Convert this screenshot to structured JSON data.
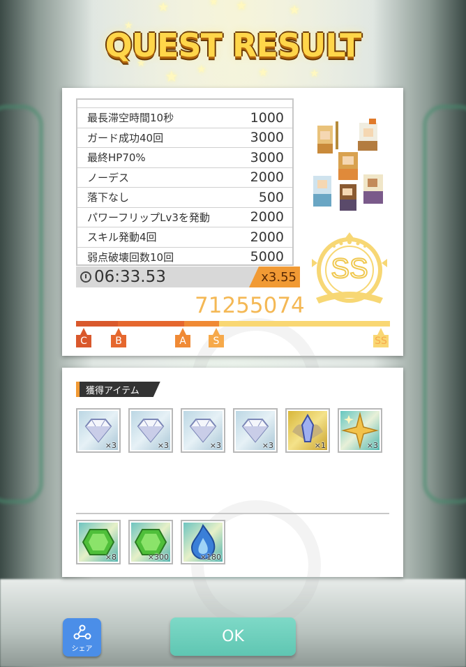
{
  "title": "QUEST RESULT",
  "bonuses": {
    "partial_top": "",
    "rows": [
      {
        "label": "最長滞空時間10秒",
        "points": "1000"
      },
      {
        "label": "ガード成功40回",
        "points": "3000"
      },
      {
        "label": "最終HP70%",
        "points": "3000"
      },
      {
        "label": "ノーデス",
        "points": "2000"
      },
      {
        "label": "落下なし",
        "points": "500"
      },
      {
        "label": "パワーフリップLv3を発動",
        "points": "2000"
      },
      {
        "label": "スキル発動4回",
        "points": "2000"
      },
      {
        "label": "弱点破壊回数10回",
        "points": "5000"
      }
    ]
  },
  "clear_time": "06:33.53",
  "multiplier": "x3.55",
  "score": "71255074",
  "rank": {
    "grade": "SS",
    "markers": [
      {
        "label": "C",
        "color": "#d9582c"
      },
      {
        "label": "B",
        "color": "#e5672e"
      },
      {
        "label": "A",
        "color": "#f08a35"
      },
      {
        "label": "S",
        "color": "#f6a94a"
      },
      {
        "label": "SS",
        "color": "#f9d773"
      }
    ]
  },
  "items_section": {
    "label": "獲得アイテム",
    "row1": [
      {
        "icon": "diamond-icon",
        "qty": "×3"
      },
      {
        "icon": "diamond-icon",
        "qty": "×3"
      },
      {
        "icon": "diamond-icon",
        "qty": "×3"
      },
      {
        "icon": "diamond-icon",
        "qty": "×3"
      },
      {
        "icon": "winged-crystal-icon",
        "qty": "×1"
      },
      {
        "icon": "sparkle-star-icon",
        "qty": "×3"
      }
    ],
    "row2": [
      {
        "icon": "green-gem-icon",
        "qty": "×8"
      },
      {
        "icon": "green-gem-icon",
        "qty": "×300"
      },
      {
        "icon": "blue-flame-icon",
        "qty": "×180"
      }
    ]
  },
  "buttons": {
    "share": "シェア",
    "ok": "OK"
  }
}
